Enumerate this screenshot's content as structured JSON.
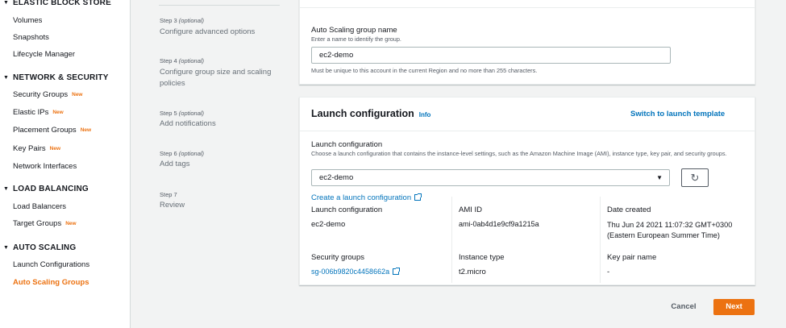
{
  "sidebar": {
    "sections": [
      {
        "title": "ELASTIC BLOCK STORE"
      },
      {
        "title": "NETWORK & SECURITY"
      },
      {
        "title": "LOAD BALANCING"
      },
      {
        "title": "AUTO SCALING"
      }
    ],
    "items": [
      {
        "label": "Volumes",
        "badge": ""
      },
      {
        "label": "Snapshots",
        "badge": ""
      },
      {
        "label": "Lifecycle Manager",
        "badge": ""
      },
      {
        "label": "Security Groups",
        "badge": "New"
      },
      {
        "label": "Elastic IPs",
        "badge": "New"
      },
      {
        "label": "Placement Groups",
        "badge": "New"
      },
      {
        "label": "Key Pairs",
        "badge": "New"
      },
      {
        "label": "Network Interfaces",
        "badge": ""
      },
      {
        "label": "Load Balancers",
        "badge": ""
      },
      {
        "label": "Target Groups",
        "badge": "New"
      },
      {
        "label": "Launch Configurations",
        "badge": ""
      },
      {
        "label": "Auto Scaling Groups",
        "badge": ""
      }
    ]
  },
  "steps": [
    {
      "num": "Step 3",
      "optional": "(optional)",
      "title": "Configure advanced options"
    },
    {
      "num": "Step 4",
      "optional": "(optional)",
      "title": "Configure group size and scaling policies"
    },
    {
      "num": "Step 5",
      "optional": "(optional)",
      "title": "Add notifications"
    },
    {
      "num": "Step 6",
      "optional": "(optional)",
      "title": "Add tags"
    },
    {
      "num": "Step 7",
      "optional": "",
      "title": "Review"
    }
  ],
  "name_panel": {
    "field_label": "Auto Scaling group name",
    "field_hint": "Enter a name to identify the group.",
    "value": "ec2-demo",
    "constraint": "Must be unique to this account in the current Region and no more than 255 characters."
  },
  "launch_panel": {
    "title": "Launch configuration",
    "info": "Info",
    "switch_link": "Switch to launch template",
    "field_label": "Launch configuration",
    "field_desc": "Choose a launch configuration that contains the instance-level settings, such as the Amazon Machine Image (AMI), instance type, key pair, and security groups.",
    "selected": "ec2-demo",
    "create_link": "Create a launch configuration",
    "details": [
      {
        "label": "Launch configuration",
        "value": "ec2-demo"
      },
      {
        "label": "AMI ID",
        "value": "ami-0ab4d1e9cf9a1215a"
      },
      {
        "label": "Date created",
        "value": "Thu Jun 24 2021 11:07:32 GMT+0300 (Eastern European Summer Time)"
      },
      {
        "label": "Security groups",
        "value": "sg-006b9820c4458662a"
      },
      {
        "label": "Instance type",
        "value": "t2.micro"
      },
      {
        "label": "Key pair name",
        "value": "-"
      }
    ]
  },
  "footer": {
    "cancel": "Cancel",
    "next": "Next"
  },
  "colors": {
    "accent": "#ec7211",
    "link": "#0073bb"
  }
}
